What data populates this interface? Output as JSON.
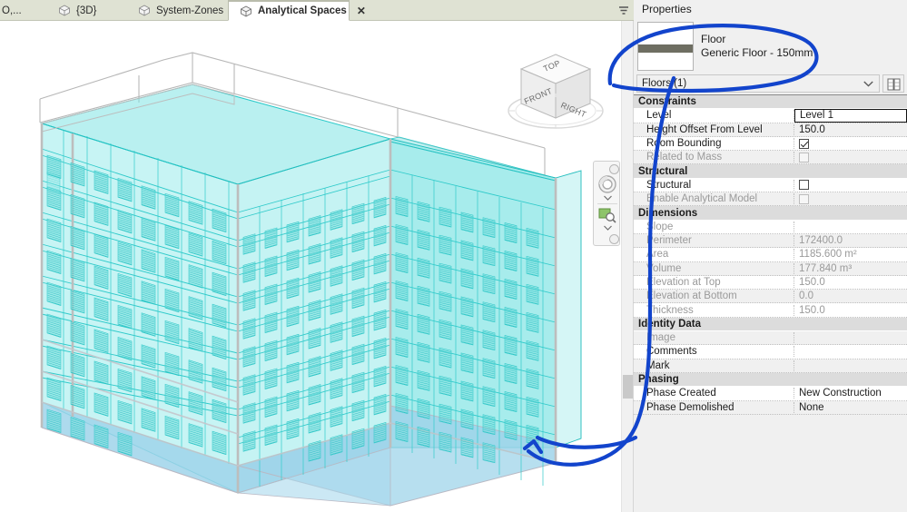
{
  "tabbar": {
    "tabs": [
      {
        "label": "O,...",
        "icon": "none",
        "active": false,
        "truncated": true
      },
      {
        "label": "{3D}",
        "icon": "cube-icon",
        "active": false,
        "truncated": false
      },
      {
        "label": "System-Zones",
        "icon": "cube-icon",
        "active": false,
        "truncated": false
      },
      {
        "label": "Analytical Spaces",
        "icon": "cube-icon",
        "active": true,
        "truncated": false,
        "close": "✕"
      }
    ],
    "tab_list_button": "tab-list-dropdown"
  },
  "viewcube": {
    "front_label": "FRONT",
    "right_label": "RIGHT",
    "top_label": "TOP"
  },
  "navigation_bar": {
    "items": [
      "steering-wheels",
      "zoom-tools"
    ],
    "help_dot": "help",
    "options_dot": "options"
  },
  "properties": {
    "title": "Properties",
    "type_selector": {
      "family": "Floor",
      "type": "Generic Floor - 150mm"
    },
    "instance_combo": "Floors (1)",
    "edit_type_button": "Edit Type",
    "groups": [
      {
        "name": "Constraints",
        "rows": [
          {
            "name": "Level",
            "value": "Level 1",
            "kind": "text",
            "editing": true,
            "disabled": false
          },
          {
            "name": "Height Offset From Level",
            "value": "150.0",
            "kind": "text",
            "editing": false,
            "disabled": false
          },
          {
            "name": "Room Bounding",
            "value": "",
            "kind": "checkbox",
            "checked": true,
            "disabled": false
          },
          {
            "name": "Related to Mass",
            "value": "",
            "kind": "checkbox",
            "checked": false,
            "disabled": true
          }
        ]
      },
      {
        "name": "Structural",
        "rows": [
          {
            "name": "Structural",
            "value": "",
            "kind": "checkbox",
            "checked": false,
            "disabled": false
          },
          {
            "name": "Enable Analytical Model",
            "value": "",
            "kind": "checkbox",
            "checked": false,
            "disabled": true
          }
        ]
      },
      {
        "name": "Dimensions",
        "rows": [
          {
            "name": "Slope",
            "value": "",
            "kind": "text",
            "editing": false,
            "disabled": true
          },
          {
            "name": "Perimeter",
            "value": "172400.0",
            "kind": "text",
            "editing": false,
            "disabled": true
          },
          {
            "name": "Area",
            "value": "1185.600 m²",
            "kind": "text",
            "editing": false,
            "disabled": true
          },
          {
            "name": "Volume",
            "value": "177.840 m³",
            "kind": "text",
            "editing": false,
            "disabled": true
          },
          {
            "name": "Elevation at Top",
            "value": "150.0",
            "kind": "text",
            "editing": false,
            "disabled": true
          },
          {
            "name": "Elevation at Bottom",
            "value": "0.0",
            "kind": "text",
            "editing": false,
            "disabled": true
          },
          {
            "name": "Thickness",
            "value": "150.0",
            "kind": "text",
            "editing": false,
            "disabled": true
          }
        ]
      },
      {
        "name": "Identity Data",
        "rows": [
          {
            "name": "Image",
            "value": "",
            "kind": "text",
            "editing": false,
            "disabled": true
          },
          {
            "name": "Comments",
            "value": "",
            "kind": "text",
            "editing": false,
            "disabled": false
          },
          {
            "name": "Mark",
            "value": "",
            "kind": "text",
            "editing": false,
            "disabled": false
          }
        ]
      },
      {
        "name": "Phasing",
        "rows": [
          {
            "name": "Phase Created",
            "value": "New Construction",
            "kind": "text",
            "editing": false,
            "disabled": false
          },
          {
            "name": "Phase Demolished",
            "value": "None",
            "kind": "text",
            "editing": false,
            "disabled": false
          }
        ]
      }
    ]
  },
  "annotation": {
    "color": "#1244cc",
    "shapes": [
      "ellipse-around-type-selector",
      "curved-arrow-to-floor-slab"
    ]
  },
  "colors": {
    "tabbar_bg": "#dfe2d3",
    "panel_bg": "#f0f0f0",
    "group_header_bg": "#dcdcdc",
    "model_cyan": "#29d4d4",
    "model_floor_blue": "#8fd0e8",
    "annotation_blue": "#1244cc"
  }
}
